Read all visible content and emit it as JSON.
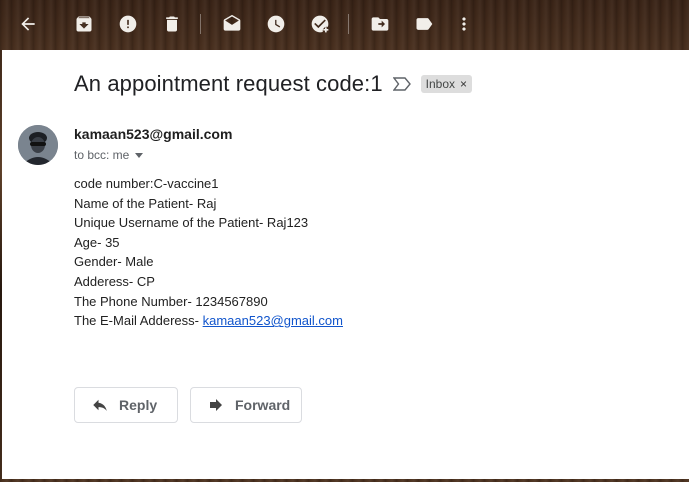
{
  "toolbar": {
    "icons": [
      "back-arrow-icon",
      "archive-icon",
      "report-spam-icon",
      "delete-icon",
      "mark-unread-icon",
      "snooze-icon",
      "add-to-tasks-icon",
      "move-to-icon",
      "label-icon",
      "more-options-icon"
    ]
  },
  "message": {
    "subject": "An appointment request code:1",
    "label": "Inbox",
    "label_close": "×",
    "sender_email": "kamaan523@gmail.com",
    "recipient_line": "to bcc: me",
    "body_lines": [
      "code number:C-vaccine1",
      "Name of the Patient- Raj",
      "Unique Username of the Patient- Raj123",
      "Age- 35",
      "Gender- Male",
      "Adderess- CP",
      "The Phone Number- 1234567890"
    ],
    "email_line_prefix": "The E-Mail Adderess- ",
    "email_link": "kamaan523@gmail.com"
  },
  "actions": {
    "reply_label": "Reply",
    "forward_label": "Forward"
  },
  "colors": {
    "link": "#1155cc",
    "chip_bg": "#dddddd"
  }
}
